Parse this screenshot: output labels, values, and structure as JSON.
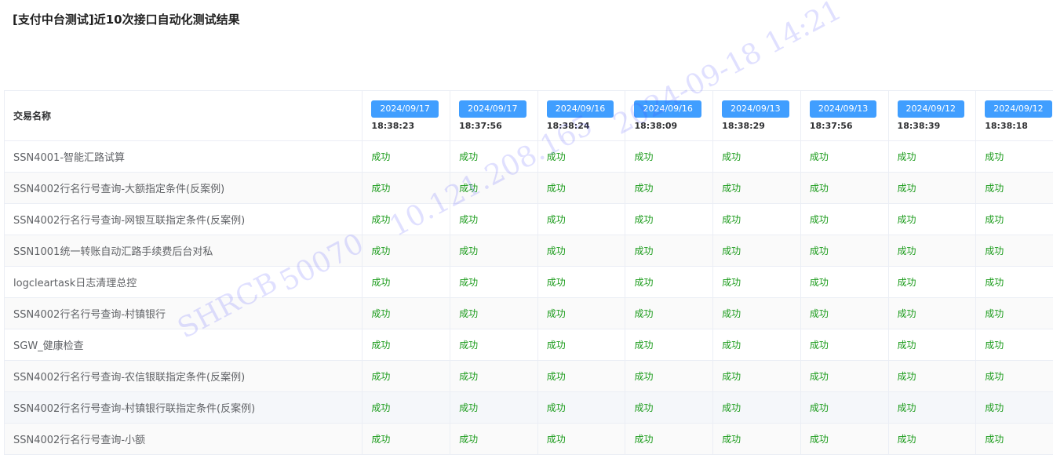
{
  "page": {
    "title": "[支付中台测试]近10次接口自动化测试结果"
  },
  "table": {
    "name_header": "交易名称",
    "runs": [
      {
        "date": "2024/09/17",
        "time": "18:38:23"
      },
      {
        "date": "2024/09/17",
        "time": "18:37:56"
      },
      {
        "date": "2024/09/16",
        "time": "18:38:24"
      },
      {
        "date": "2024/09/16",
        "time": "18:38:09"
      },
      {
        "date": "2024/09/13",
        "time": "18:38:29"
      },
      {
        "date": "2024/09/13",
        "time": "18:37:56"
      },
      {
        "date": "2024/09/12",
        "time": "18:38:39"
      },
      {
        "date": "2024/09/12",
        "time": "18:38:18"
      }
    ],
    "rows": [
      {
        "name": "SSN4001-智能汇路试算",
        "results": [
          "成功",
          "成功",
          "成功",
          "成功",
          "成功",
          "成功",
          "成功",
          "成功"
        ]
      },
      {
        "name": "SSN4002行名行号查询-大额指定条件(反案例)",
        "results": [
          "成功",
          "成功",
          "成功",
          "成功",
          "成功",
          "成功",
          "成功",
          "成功"
        ]
      },
      {
        "name": "SSN4002行名行号查询-网银互联指定条件(反案例)",
        "results": [
          "成功",
          "成功",
          "成功",
          "成功",
          "成功",
          "成功",
          "成功",
          "成功"
        ]
      },
      {
        "name": "SSN1001统一转账自动汇路手续费后台对私",
        "results": [
          "成功",
          "成功",
          "成功",
          "成功",
          "成功",
          "成功",
          "成功",
          "成功"
        ]
      },
      {
        "name": "logcleartask日志清理总控",
        "results": [
          "成功",
          "成功",
          "成功",
          "成功",
          "成功",
          "成功",
          "成功",
          "成功"
        ]
      },
      {
        "name": "SSN4002行名行号查询-村镇银行",
        "results": [
          "成功",
          "成功",
          "成功",
          "成功",
          "成功",
          "成功",
          "成功",
          "成功"
        ]
      },
      {
        "name": "SGW_健康检查",
        "results": [
          "成功",
          "成功",
          "成功",
          "成功",
          "成功",
          "成功",
          "成功",
          "成功"
        ]
      },
      {
        "name": "SSN4002行名行号查询-农信银联指定条件(反案例)",
        "results": [
          "成功",
          "成功",
          "成功",
          "成功",
          "成功",
          "成功",
          "成功",
          "成功"
        ]
      },
      {
        "name": "SSN4002行名行号查询-村镇银行联指定条件(反案例)",
        "results": [
          "成功",
          "成功",
          "成功",
          "成功",
          "成功",
          "成功",
          "成功",
          "成功"
        ]
      },
      {
        "name": "SSN4002行名行号查询-小额",
        "results": [
          "成功",
          "成功",
          "成功",
          "成功",
          "成功",
          "成功",
          "成功",
          "成功"
        ]
      }
    ]
  },
  "watermark": {
    "org": "SHRCB",
    "id": "50070",
    "ip": "10.121.208.165",
    "datetime": "2024-09-18 14:21",
    "color": "#3c3cff"
  },
  "colors": {
    "tag_bg": "#409eff",
    "success_text": "#1a9b1a"
  }
}
